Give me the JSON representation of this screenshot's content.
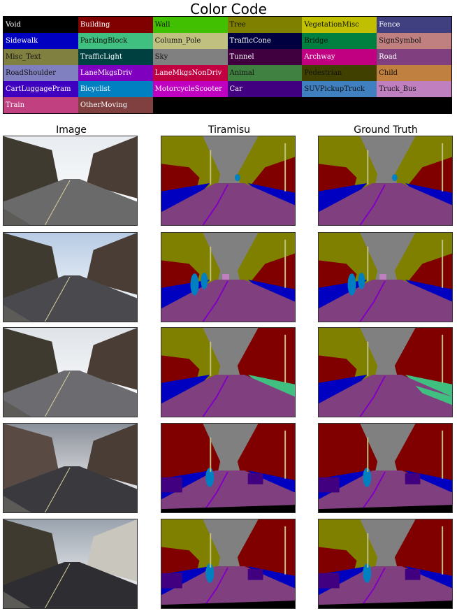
{
  "figure": {
    "title": "Color Code",
    "column_headers": [
      "Image",
      "Tiramisu",
      "Ground Truth"
    ]
  },
  "legend": [
    {
      "label": "Void",
      "color": "#000000"
    },
    {
      "label": "Building",
      "color": "#800000"
    },
    {
      "label": "Wall",
      "color": "#40c000"
    },
    {
      "label": "Tree",
      "color": "#808000"
    },
    {
      "label": "VegetationMisc",
      "color": "#c0c000"
    },
    {
      "label": "Fence",
      "color": "#404080"
    },
    {
      "label": "Sidewalk",
      "color": "#0000c0"
    },
    {
      "label": "ParkingBlock",
      "color": "#40c080"
    },
    {
      "label": "Column_Pole",
      "color": "#c0c080"
    },
    {
      "label": "TrafficCone",
      "color": "#000040"
    },
    {
      "label": "Bridge",
      "color": "#008040"
    },
    {
      "label": "SignSymbol",
      "color": "#c08080"
    },
    {
      "label": "Misc_Text",
      "color": "#808040"
    },
    {
      "label": "TrafficLight",
      "color": "#004040"
    },
    {
      "label": "Sky",
      "color": "#808080"
    },
    {
      "label": "Tunnel",
      "color": "#400040"
    },
    {
      "label": "Archway",
      "color": "#c00080"
    },
    {
      "label": "Road",
      "color": "#804080"
    },
    {
      "label": "RoadShoulder",
      "color": "#8080c0"
    },
    {
      "label": "LaneMkgsDriv",
      "color": "#8000c0"
    },
    {
      "label": "LaneMkgsNonDriv",
      "color": "#c00040"
    },
    {
      "label": "Animal",
      "color": "#408040"
    },
    {
      "label": "Pedestrian",
      "color": "#404000"
    },
    {
      "label": "Child",
      "color": "#c08040"
    },
    {
      "label": "CartLuggagePram",
      "color": "#4000c0"
    },
    {
      "label": "Bicyclist",
      "color": "#0080c0"
    },
    {
      "label": "MotorcycleScooter",
      "color": "#c000c0"
    },
    {
      "label": "Car",
      "color": "#400080"
    },
    {
      "label": "SUVPickupTruck",
      "color": "#4080c0"
    },
    {
      "label": "Truck_Bus",
      "color": "#c080c0"
    },
    {
      "label": "Train",
      "color": "#c04080"
    },
    {
      "label": "OtherMoving",
      "color": "#804040"
    },
    {
      "label": "",
      "color": "#000000"
    },
    {
      "label": "",
      "color": "#000000"
    },
    {
      "label": "",
      "color": "#000000"
    },
    {
      "label": "",
      "color": "#000000"
    }
  ],
  "light_text_labels": [
    "Wall",
    "Tree",
    "VegetationMisc",
    "Column_Pole",
    "Sky",
    "RoadShoulder",
    "Animal",
    "Pedestrian",
    "Child",
    "SUVPickupTruck",
    "Truck_Bus",
    "SignSymbol",
    "Misc_Text",
    "ParkingBlock",
    "Bridge"
  ],
  "rows": 5,
  "palette": {
    "sky": "#808080",
    "building": "#800000",
    "tree": "#808000",
    "vegmisc": "#c0c000",
    "sidewalk": "#0000c0",
    "road": "#804080",
    "lane": "#8000c0",
    "shoulder": "#8080c0",
    "parking": "#40c080",
    "pole": "#c0c080",
    "car": "#400080",
    "bicyclist": "#0080c0",
    "pedestrian": "#404000",
    "void": "#000000",
    "wall": "#40c000",
    "sign": "#c08080",
    "truck": "#c080c0"
  }
}
